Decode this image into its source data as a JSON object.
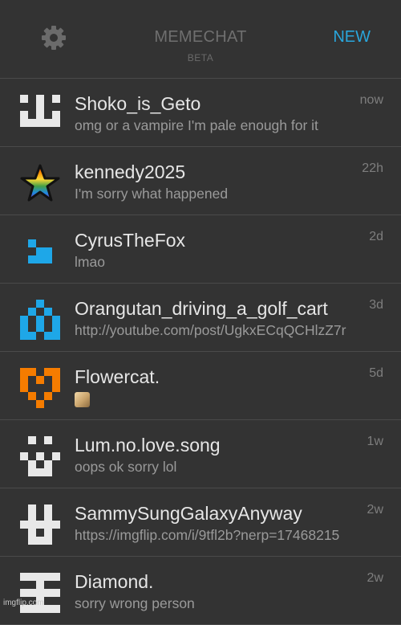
{
  "header": {
    "title": "MEMECHAT",
    "subtitle": "BETA",
    "new_label": "NEW",
    "settings_icon": "gear-icon"
  },
  "colors": {
    "background": "#333333",
    "accent": "#29a6dc",
    "name": "#e6e6e6",
    "message": "#9a9a9a",
    "divider": "#4a4a4a"
  },
  "chats": [
    {
      "name": "Shoko_is_Geto",
      "message": "omg or a vampire I'm pale enough for it",
      "time": "now",
      "avatar": "white-smile-pixel-avatar"
    },
    {
      "name": "kennedy2025",
      "message": "I'm sorry what happened",
      "time": "22h",
      "avatar": "rainbow-star-avatar"
    },
    {
      "name": "CyrusTheFox",
      "message": "lmao",
      "time": "2d",
      "avatar": "blue-pixel-avatar"
    },
    {
      "name": "Orangutan_driving_a_golf_cart",
      "message": "http://youtube.com/post/UgkxECqQCHlzZ7r",
      "time": "3d",
      "avatar": "blue-pixel-pattern-avatar"
    },
    {
      "name": "Flowercat.",
      "message": "",
      "time": "5d",
      "avatar": "orange-heart-pixel-avatar",
      "attachment": "image-thumbnail-icon"
    },
    {
      "name": "Lum.no.love.song",
      "message": "oops ok sorry lol",
      "time": "1w",
      "avatar": "white-pixel-avatar"
    },
    {
      "name": "SammySungGalaxyAnyway",
      "message": "https://imgflip.com/i/9tfl2b?nerp=17468215",
      "time": "2w",
      "avatar": "white-pixel-pattern-avatar"
    },
    {
      "name": "Diamond.",
      "message": "sorry wrong person",
      "time": "2w",
      "avatar": "white-cross-pixel-avatar"
    }
  ],
  "watermark": "imgflip.com"
}
